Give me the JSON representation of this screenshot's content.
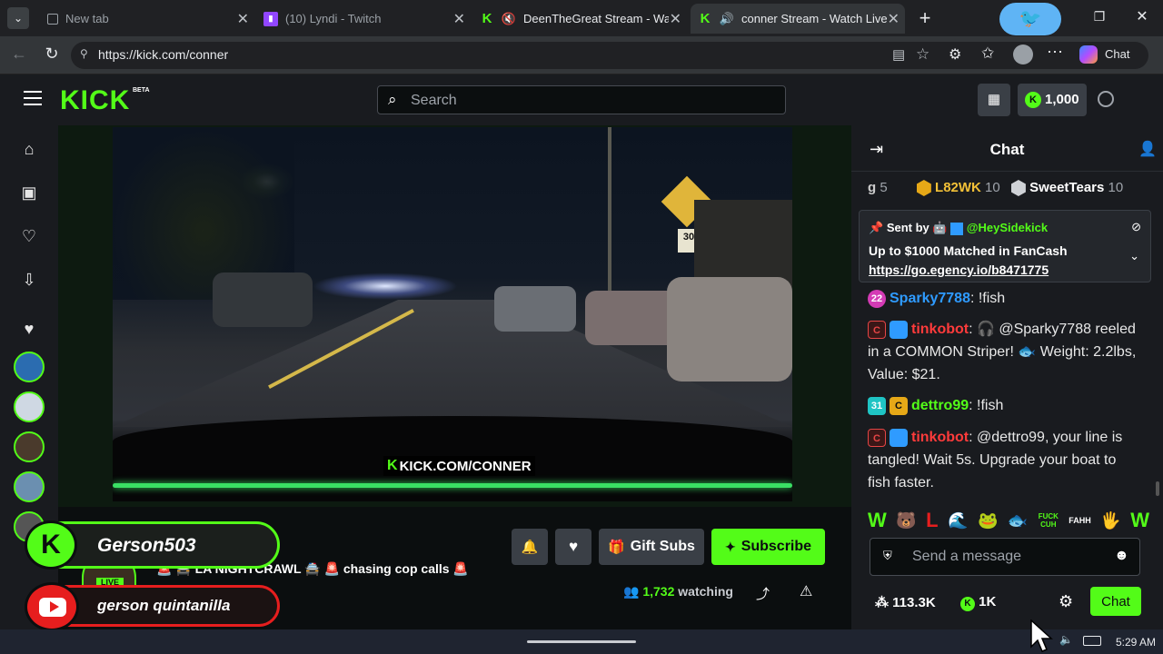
{
  "browser": {
    "tabs": [
      {
        "title": "New tab",
        "active": false
      },
      {
        "title": "(10) Lyndi - Twitch",
        "active": false
      },
      {
        "title": "DeenTheGreat Stream - Watch",
        "active": false
      },
      {
        "title": "conner Stream - Watch Live o",
        "active": true
      }
    ],
    "url": "https://kick.com/conner",
    "copilot_label": "Chat"
  },
  "kick": {
    "logo": "KICK",
    "logo_badge": "BETA",
    "search_placeholder": "Search",
    "points": "1,000"
  },
  "stream": {
    "overlay_text": "KICK.COM/CONNER",
    "title_line": "🚨 🚔 LA NIGHTCRAWL 🚔 🚨 chasing cop calls 🚨",
    "live_badge": "LIVE",
    "gift_subs_label": "Gift Subs",
    "subscribe_label": "Subscribe",
    "watching_count": "1,732",
    "watching_label": "watching"
  },
  "streamer_overlay": {
    "kick_name": "Gerson503",
    "youtube_name": "gerson quintanilla"
  },
  "chat": {
    "header": "Chat",
    "leaderboard": [
      {
        "name": "g",
        "count": "5"
      },
      {
        "name": "L82WK",
        "count": "10"
      },
      {
        "name": "SweetTears",
        "count": "10"
      }
    ],
    "pinned": {
      "sent_by_label": "Sent by",
      "sender": "@HeySidekick",
      "text": "Up to $1000 Matched in FanCash",
      "link": "https://go.egency.io/b8471775"
    },
    "messages": [
      {
        "badge": "22",
        "user": "Sparky7788",
        "text": ": !fish"
      },
      {
        "user": "tinkobot",
        "text": ": 🎧 @Sparky7788 reeled in a COMMON Striper! 🐟 Weight: 2.2lbs, Value: $21."
      },
      {
        "badge": "31",
        "user": "dettro99",
        "text": ": !fish"
      },
      {
        "user": "tinkobot",
        "text": ": @dettro99, your line is tangled! Wait 5s. Upgrade your boat to fish faster."
      }
    ],
    "emotes": [
      "W",
      "🐻",
      "L",
      "🌊",
      "🐸",
      "🐟",
      "FUCK CUH",
      "FAHH",
      "🖐",
      "W"
    ],
    "input_placeholder": "Send a message",
    "followers": "113.3K",
    "kick_points": "1K",
    "send_label": "Chat"
  },
  "taskbar": {
    "time": "5:29 AM"
  },
  "colors": {
    "kick_green": "#53fc18",
    "bg_dark": "#0b0e0f",
    "panel": "#191b1f",
    "red_user": "#ff3b3b",
    "blue_user": "#2f9bff"
  }
}
